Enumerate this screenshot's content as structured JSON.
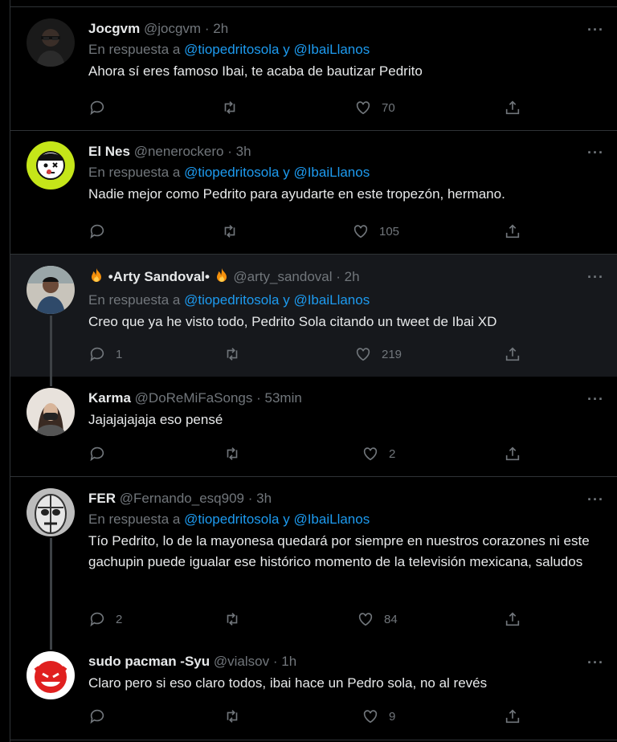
{
  "reply_prefix": "En respuesta a",
  "reply_joiner": "y",
  "more_icon": "···",
  "tweets": [
    {
      "name": "Jocgvm",
      "handle": "@jocgvm",
      "sep": "·",
      "time": "2h",
      "reply_to": [
        "@tiopedritosola",
        "@IbaiLlanos"
      ],
      "text": "Ahora sí eres famoso Ibai, te acaba de bautizar Pedrito",
      "replies": "",
      "retweets": "",
      "likes": "70"
    },
    {
      "name": "El Nes",
      "handle": "@nenerockero",
      "sep": "·",
      "time": "3h",
      "reply_to": [
        "@tiopedritosola",
        "@IbaiLlanos"
      ],
      "text": "Nadie mejor como Pedrito para ayudarte en este tropezón, hermano.",
      "replies": "",
      "retweets": "",
      "likes": "105"
    },
    {
      "name": "•Arty Sandoval•",
      "handle": "@arty_sandoval",
      "sep": "·",
      "time": "2h",
      "reply_to": [
        "@tiopedritosola",
        "@IbaiLlanos"
      ],
      "text": "Creo que ya he visto todo, Pedrito Sola citando un tweet de Ibai XD",
      "replies": "1",
      "retweets": "",
      "likes": "219"
    },
    {
      "name": "Karma",
      "handle": "@DoReMiFaSongs",
      "sep": "·",
      "time": "53min",
      "text": "Jajajajajaja eso pensé",
      "replies": "",
      "retweets": "",
      "likes": "2"
    },
    {
      "name": "FER",
      "handle": "@Fernando_esq909",
      "sep": "·",
      "time": "3h",
      "reply_to": [
        "@tiopedritosola",
        "@IbaiLlanos"
      ],
      "text": "Tío Pedrito, lo de la mayonesa quedará por siempre en nuestros corazones ni este gachupin puede igualar ese histórico momento de la televisión mexicana, saludos",
      "replies": "2",
      "retweets": "",
      "likes": "84"
    },
    {
      "name": "sudo pacman -Syu",
      "handle": "@vialsov",
      "sep": "·",
      "time": "1h",
      "text": "Claro pero si eso claro todos, ibai hace un Pedro sola, no al revés",
      "replies": "",
      "retweets": "",
      "likes": "9"
    }
  ],
  "colors": {
    "background": "#000000",
    "highlight": "#16181c",
    "link": "#1d9bf0",
    "muted": "#71767b",
    "border": "#2f3336"
  }
}
